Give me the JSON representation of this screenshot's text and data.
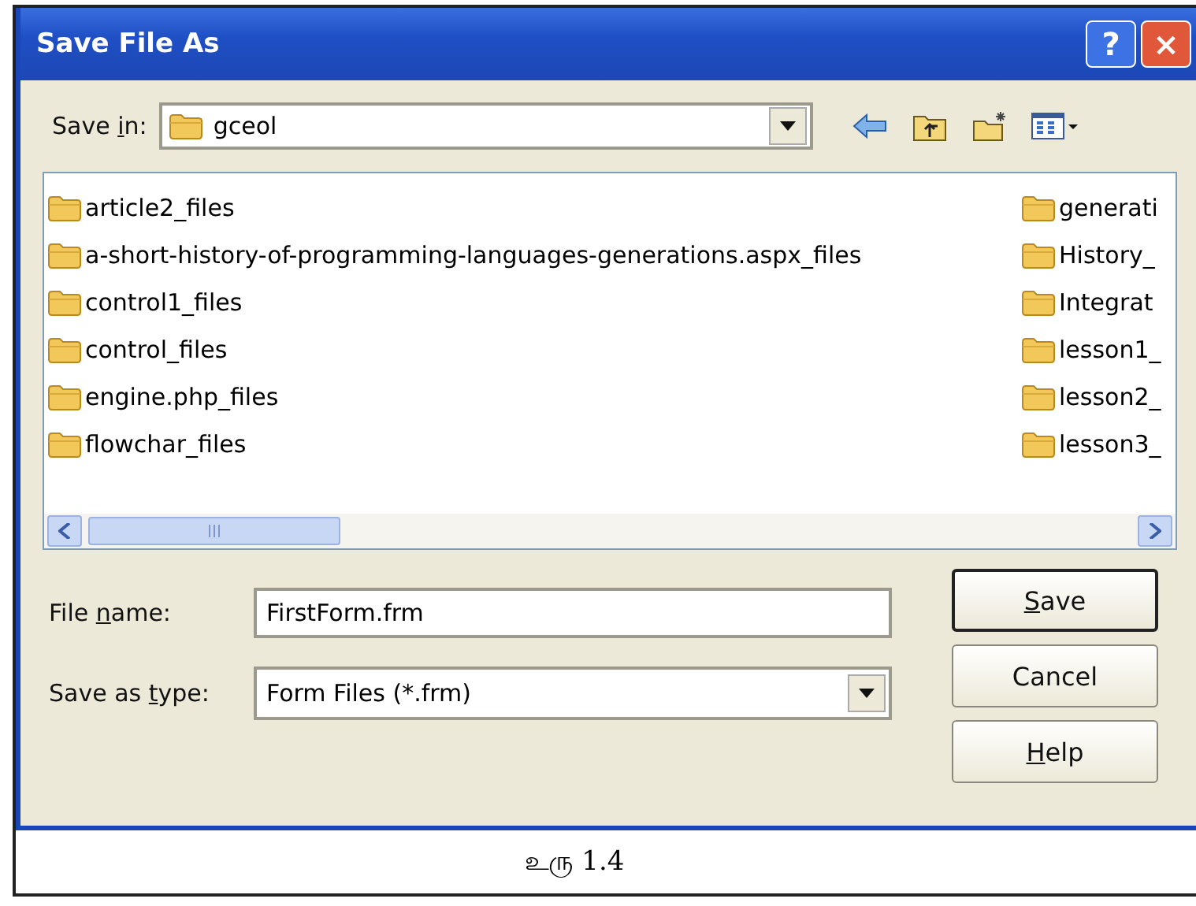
{
  "window": {
    "title": "Save File As",
    "title_buttons": [
      "?",
      "×"
    ]
  },
  "save_in": {
    "label": {
      "pre": "Save ",
      "key": "i",
      "post": "n:"
    },
    "value": "gceol"
  },
  "files": {
    "column_1": [
      "article2_files",
      "a-short-history-of-programming-languages-generations.aspx_files",
      "control1_files",
      "control_files",
      "engine.php_files",
      "flowchar_files"
    ],
    "column_2": [
      "generati",
      "History_",
      "Integrat",
      "lesson1_",
      "lesson2_",
      "lesson3_"
    ]
  },
  "file_name": {
    "label": {
      "pre": "File ",
      "key": "n",
      "post": "ame:"
    },
    "value": "FirstForm.frm"
  },
  "save_as_type": {
    "label": {
      "pre": "Save as ",
      "key": "t",
      "post": "ype:"
    },
    "value": "Form Files (*.frm)"
  },
  "buttons": [
    {
      "label": {
        "key": "S",
        "post": "ave"
      },
      "default": true
    },
    {
      "label": {
        "pre": "Cancel"
      },
      "default": false
    },
    {
      "label": {
        "key": "H",
        "post": "elp"
      },
      "default": false
    }
  ],
  "caption": "உரு 1.4"
}
